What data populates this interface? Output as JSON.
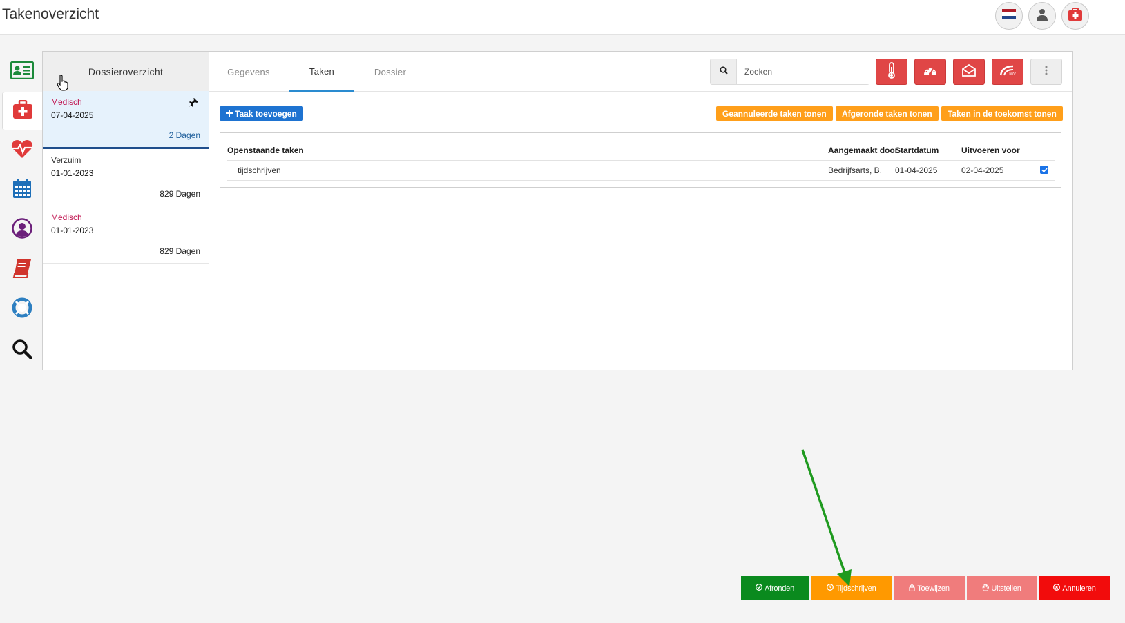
{
  "header": {
    "title": "Takenoverzicht",
    "buttons": [
      "flag-icon",
      "user-icon",
      "first-aid-icon"
    ]
  },
  "sidebar": {
    "items": [
      "id-card-icon",
      "first-aid-kit-icon",
      "heartbeat-icon",
      "calendar-icon",
      "user-circle-icon",
      "book-icon",
      "lifebuoy-icon",
      "search-icon"
    ],
    "active": 1
  },
  "dossier": {
    "title": "Dossieroverzicht",
    "items": [
      {
        "type": "Medisch",
        "date": "07-04-2025",
        "days": "2 Dagen",
        "selected": true,
        "pinned": true
      },
      {
        "type": "Verzuim",
        "date": "01-01-2023",
        "days": "829 Dagen",
        "selected": false,
        "pinned": false
      },
      {
        "type": "Medisch",
        "date": "01-01-2023",
        "days": "829 Dagen",
        "selected": false,
        "pinned": false
      }
    ]
  },
  "tabs": [
    {
      "label": "Gegevens",
      "active": false
    },
    {
      "label": "Taken",
      "active": true
    },
    {
      "label": "Dossier",
      "active": false
    }
  ],
  "search": {
    "placeholder": "Zoeken",
    "value": ""
  },
  "toolbar": {
    "icons": [
      "thermometer-icon",
      "dashboard-icon",
      "envelope-open-icon",
      "uwv-icon",
      "more-icon"
    ]
  },
  "actions": {
    "add_task": "Taak toevoegen",
    "cancelled": "Geannuleerde taken tonen",
    "completed": "Afgeronde taken tonen",
    "future": "Taken in de toekomst tonen"
  },
  "tasks": {
    "columns": [
      "Openstaande taken",
      "Aangemaakt door",
      "Startdatum",
      "Uitvoeren voor"
    ],
    "rows": [
      {
        "name": "tijdschrijven",
        "created_by": "Bedrijfsarts, B.",
        "start": "01-04-2025",
        "due": "02-04-2025",
        "checked": true
      }
    ]
  },
  "footer": {
    "buttons": [
      {
        "label": "Afronden",
        "color": "#0a8a1e"
      },
      {
        "label": "Tijdschrijven",
        "color": "#ff9900"
      },
      {
        "label": "Toewijzen",
        "color": "#f07c7c"
      },
      {
        "label": "Uitstellen",
        "color": "#f07c7c"
      },
      {
        "label": "Annuleren",
        "color": "#f20c0c"
      }
    ]
  },
  "colors": {
    "accent": "#1e73d1",
    "danger": "#e04646",
    "orange": "#ff9f1a",
    "medisch": "#c0134f",
    "arrow": "#1f9a1f"
  }
}
